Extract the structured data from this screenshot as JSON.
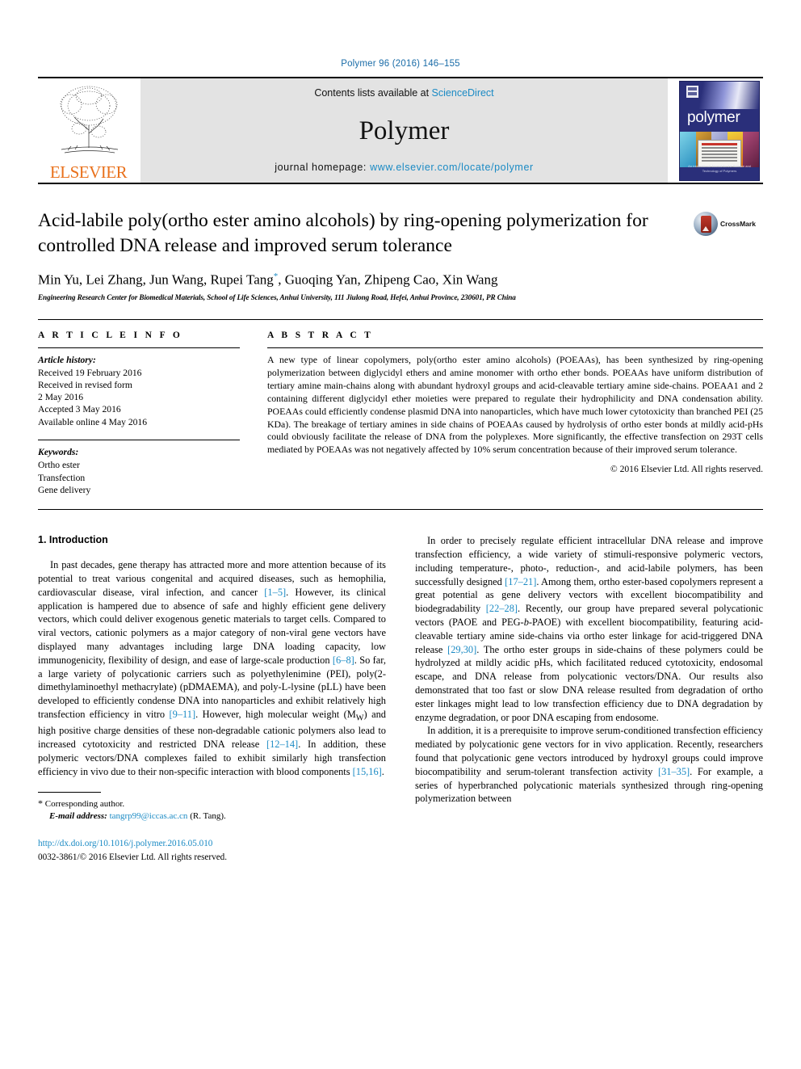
{
  "running_head": "Polymer 96 (2016) 146–155",
  "masthead": {
    "publisher": "ELSEVIER",
    "contents_prefix": "Contents lists available at ",
    "contents_link": "ScienceDirect",
    "journal_name": "Polymer",
    "homepage_prefix": "journal homepage: ",
    "homepage_url": "www.elsevier.com/locate/polymer",
    "cover_title": "polymer",
    "cover_footer": "An International Journal for the Science and Technology of Polymers"
  },
  "article": {
    "title": "Acid-labile poly(ortho ester amino alcohols) by ring-opening polymerization for controlled DNA release and improved serum tolerance",
    "crossmark_label": "CrossMark",
    "authors": "Min Yu, Lei Zhang, Jun Wang, Rupei Tang",
    "authors_marker": "*",
    "authors_rest": ", Guoqing Yan, Zhipeng Cao, Xin Wang",
    "affiliation": "Engineering Research Center for Biomedical Materials, School of Life Sciences, Anhui University, 111 Jiulong Road, Hefei, Anhui Province, 230601, PR China"
  },
  "article_info": {
    "heading": "A R T I C L E   I N F O",
    "history_label": "Article history:",
    "history": [
      "Received 19 February 2016",
      "Received in revised form",
      "2 May 2016",
      "Accepted 3 May 2016",
      "Available online 4 May 2016"
    ],
    "keywords_label": "Keywords:",
    "keywords": [
      "Ortho ester",
      "Transfection",
      "Gene delivery"
    ]
  },
  "abstract": {
    "heading": "A B S T R A C T",
    "text": "A new type of linear copolymers, poly(ortho ester amino alcohols) (POEAAs), has been synthesized by ring-opening polymerization between diglycidyl ethers and amine monomer with ortho ether bonds. POEAAs have uniform distribution of tertiary amine main-chains along with abundant hydroxyl groups and acid-cleavable tertiary amine side-chains. POEAA1 and 2 containing different diglycidyl ether moieties were prepared to regulate their hydrophilicity and DNA condensation ability. POEAAs could efficiently condense plasmid DNA into nanoparticles, which have much lower cytotoxicity than branched PEI (25 KDa). The breakage of tertiary amines in side chains of POEAAs caused by hydrolysis of ortho ester bonds at mildly acid-pHs could obviously facilitate the release of DNA from the polyplexes. More significantly, the effective transfection on 293T cells mediated by POEAAs was not negatively affected by 10% serum concentration because of their improved serum tolerance.",
    "copyright": "© 2016 Elsevier Ltd. All rights reserved."
  },
  "introduction": {
    "heading": "1. Introduction",
    "left_paragraph_1_a": "In past decades, gene therapy has attracted more and more attention because of its potential to treat various congenital and acquired diseases, such as hemophilia, cardiovascular disease, viral infection, and cancer ",
    "cite_1_5": "[1–5]",
    "left_paragraph_1_b": ". However, its clinical application is hampered due to absence of safe and highly efficient gene delivery vectors, which could deliver exogenous genetic materials to target cells. Compared to viral vectors, cationic polymers as a major category of non-viral gene vectors have displayed many advantages including large DNA loading capacity, low immunogenicity, flexibility of design, and ease of large-scale production ",
    "cite_6_8": "[6–8]",
    "left_paragraph_1_c": ". So far, a large variety of polycationic carriers such as polyethylenimine (PEI), poly(2-dimethylaminoethyl methacrylate) (pDMAEMA), and poly-",
    "l_lysine_sc": "L",
    "left_paragraph_1_d": "-lysine (pLL) have been developed to efficiently condense DNA into nanoparticles and exhibit relatively high transfection efficiency in vitro ",
    "cite_9_11": "[9–11]",
    "left_paragraph_1_e": ". However, high molecular weight (M",
    "mw_sub": "W",
    "left_paragraph_1_f": ") and high positive charge densities of these non-degradable cationic polymers also lead to increased cytotoxicity and restricted DNA release ",
    "cite_12_14": "[12–14]",
    "left_paragraph_1_g": ". In addition, these polymeric vectors/DNA complexes failed to exhibit similarly high transfection efficiency in vivo due to their non-specific interaction with blood components ",
    "cite_15_16": "[15,16]",
    "left_paragraph_1_h": ".",
    "right_paragraph_1_a": "In order to precisely regulate efficient intracellular DNA release and improve transfection efficiency, a wide variety of stimuli-responsive polymeric vectors, including temperature-, photo-, reduction-, and acid-labile polymers, has been successfully designed ",
    "cite_17_21": "[17–21]",
    "right_paragraph_1_b": ". Among them, ortho ester-based copolymers represent a great potential as gene delivery vectors with excellent biocompatibility and biodegradability ",
    "cite_22_28": "[22–28]",
    "right_paragraph_1_c": ". Recently, our group have prepared several polycationic vectors (PAOE and PEG-",
    "b_italic": "b",
    "right_paragraph_1_d": "-PAOE) with excellent biocompatibility, featuring acid-cleavable tertiary amine side-chains via ortho ester linkage for acid-triggered DNA release ",
    "cite_29_30": "[29,30]",
    "right_paragraph_1_e": ". The ortho ester groups in side-chains of these polymers could be hydrolyzed at mildly acidic pHs, which facilitated reduced cytotoxicity, endosomal escape, and DNA release from polycationic vectors/DNA. Our results also demonstrated that too fast or slow DNA release resulted from degradation of ortho ester linkages might lead to low transfection efficiency due to DNA degradation by enzyme degradation, or poor DNA escaping from endosome.",
    "right_paragraph_2_a": "In addition, it is a prerequisite to improve serum-conditioned transfection efficiency mediated by polycationic gene vectors for in vivo application. Recently, researchers found that polycationic gene vectors introduced by hydroxyl groups could improve biocompatibility and serum-tolerant transfection activity ",
    "cite_31_35": "[31–35]",
    "right_paragraph_2_b": ". For example, a series of hyperbranched polycationic materials synthesized through ring-opening polymerization between"
  },
  "footnote": {
    "star": "*",
    "corresponding": " Corresponding author.",
    "email_label": "E-mail address:",
    "email": "tangrp99@iccas.ac.cn",
    "email_owner": "(R. Tang)."
  },
  "publication_footer": {
    "doi": "http://dx.doi.org/10.1016/j.polymer.2016.05.010",
    "issn_line": "0032-3861/© 2016 Elsevier Ltd. All rights reserved."
  },
  "colors": {
    "link_blue": "#1a8ac4",
    "running_head_blue": "#1a6ca8",
    "elsevier_orange": "#e9711c",
    "band_gray": "#e3e3e3",
    "cover_navy": "#2a2f7a"
  }
}
